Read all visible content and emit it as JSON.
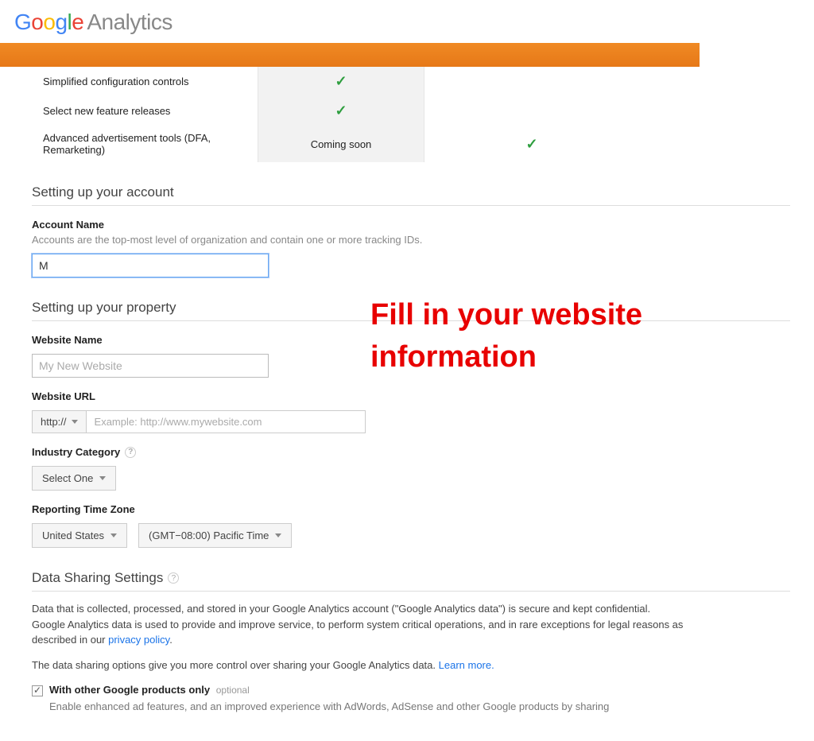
{
  "logo": {
    "google": "Google",
    "product": "Analytics"
  },
  "feature_table": {
    "rows": [
      {
        "label": "Simplified configuration controls",
        "col2": "check",
        "col3": ""
      },
      {
        "label": "Select new feature releases",
        "col2": "check",
        "col3": ""
      },
      {
        "label": "Advanced advertisement tools (DFA, Remarketing)",
        "col2": "Coming soon",
        "col3": "check"
      }
    ]
  },
  "account_section": {
    "title": "Setting up your account",
    "name_label": "Account Name",
    "name_help": "Accounts are the top-most level of organization and contain one or more tracking IDs.",
    "name_value": "M"
  },
  "property_section": {
    "title": "Setting up your property",
    "website_name_label": "Website Name",
    "website_name_placeholder": "My New Website",
    "website_url_label": "Website URL",
    "url_scheme": "http://",
    "url_placeholder": "Example: http://www.mywebsite.com",
    "industry_label": "Industry Category",
    "industry_value": "Select One",
    "timezone_label": "Reporting Time Zone",
    "timezone_country": "United States",
    "timezone_value": "(GMT−08:00) Pacific Time"
  },
  "data_sharing": {
    "title": "Data Sharing Settings",
    "para1_a": "Data that is collected, processed, and stored in your Google Analytics account (\"Google Analytics data\") is secure and kept confidential. Google Analytics data is used to provide and improve service, to perform system critical operations, and in rare exceptions for legal reasons as described in our ",
    "privacy_link": "privacy policy",
    "para1_b": ".",
    "para2_a": "The data sharing options give you more control over sharing your Google Analytics data. ",
    "learn_more": "Learn more.",
    "opt1_label": "With other Google products only",
    "opt1_optional": "optional",
    "opt1_desc": "Enable enhanced ad features, and an improved experience with AdWords, AdSense and other Google products by sharing"
  },
  "annotation": {
    "text": "Fill in your website information"
  }
}
